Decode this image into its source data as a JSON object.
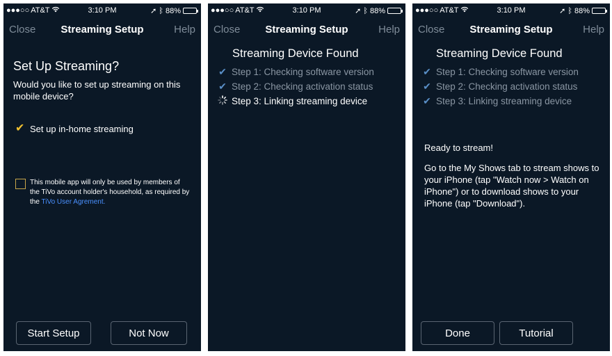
{
  "status": {
    "carrier": "AT&T",
    "time": "3:10 PM",
    "battery": "88%",
    "battery_fraction": 0.88
  },
  "nav": {
    "close": "Close",
    "title": "Streaming Setup",
    "help": "Help"
  },
  "screen1": {
    "heading": "Set Up Streaming?",
    "question": "Would you like to set up streaming on this mobile device?",
    "option_label": "Set up in-home streaming",
    "option_checked": true,
    "agreement_text": "This mobile app will only be used by members of the TiVo account holder's household, as required by the",
    "agreement_link": "TiVo User Agrement",
    "agreement_end": ".",
    "agreement_checked": false,
    "start_button": "Start Setup",
    "not_now_button": "Not Now"
  },
  "screen2": {
    "heading": "Streaming Device Found",
    "steps": [
      {
        "label": "Step 1: Checking software version",
        "state": "done"
      },
      {
        "label": "Step 2: Checking activation status",
        "state": "done"
      },
      {
        "label": "Step 3: Linking streaming device",
        "state": "in-progress"
      }
    ]
  },
  "screen3": {
    "heading": "Streaming Device Found",
    "steps": [
      {
        "label": "Step 1: Checking software version",
        "state": "done"
      },
      {
        "label": "Step 2: Checking activation status",
        "state": "done"
      },
      {
        "label": "Step 3: Linking streaming device",
        "state": "done"
      }
    ],
    "ready": "Ready to stream!",
    "instructions": "Go to the My Shows tab to stream shows to your iPhone (tap \"Watch now > Watch on iPhone\") or to download shows to your iPhone (tap \"Download\").",
    "done_button": "Done",
    "tutorial_button": "Tutorial"
  },
  "colors": {
    "background": "#0b1826",
    "accent_check": "#f0c030",
    "step_check": "#5a8fc7",
    "link": "#4a90ff"
  }
}
